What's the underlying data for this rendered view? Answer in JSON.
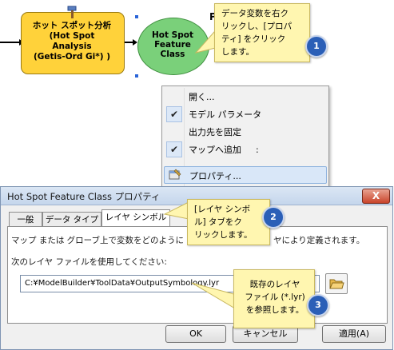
{
  "model": {
    "tool_label": "ホット スポット分析\n(Hot Spot\nAnalysis\n(Getis-Ord Gi*) )",
    "variable_label": "Hot Spot\nFeature\nClass",
    "p_label": "P"
  },
  "context_menu": {
    "items": [
      {
        "label": "開く...",
        "checked": false
      },
      {
        "label": "モデル パラメータ",
        "checked": true
      },
      {
        "label": "出力先を固定",
        "checked": false
      },
      {
        "label": "マップへ追加",
        "checked": true
      },
      {
        "label": "プロパティ...",
        "checked": false,
        "highlighted": true
      }
    ],
    "ellipsis": ":"
  },
  "callouts": [
    {
      "number": "1",
      "text": "データ変数を右ク\nリックし、[プロパ\nティ] をクリック\nします。"
    },
    {
      "number": "2",
      "text": "[レイヤ シンボ\nル] タブをク\nリックします。"
    },
    {
      "number": "3",
      "text": "既存のレイヤ\nファイル (*.lyr)\nを参照します。"
    }
  ],
  "dialog": {
    "title": "Hot Spot Feature Class プロパティ",
    "close_glyph": "X",
    "tabs": [
      {
        "label": "一般"
      },
      {
        "label": "データ タイプ"
      },
      {
        "label": "レイヤ シンボル",
        "active": true
      }
    ],
    "description_left": "マップ または グローブ上で変数をどのように",
    "description_right": "ヤにより定義されます。",
    "use_layer_file_label": "次のレイヤ ファイルを使用してください:",
    "layer_file_path": "C:¥ModelBuilder¥ToolData¥OutputSymbology.lyr",
    "buttons": {
      "ok": "OK",
      "cancel": "キャンセル",
      "apply": "適用(A)"
    }
  },
  "colors": {
    "tool_fill": "#ffd23a",
    "variable_fill": "#7ad07a",
    "callout_fill": "#fff6b0",
    "step_badge": "#2b5fb7",
    "menu_highlight": "#d9e7f8",
    "close_button": "#c9442a"
  }
}
